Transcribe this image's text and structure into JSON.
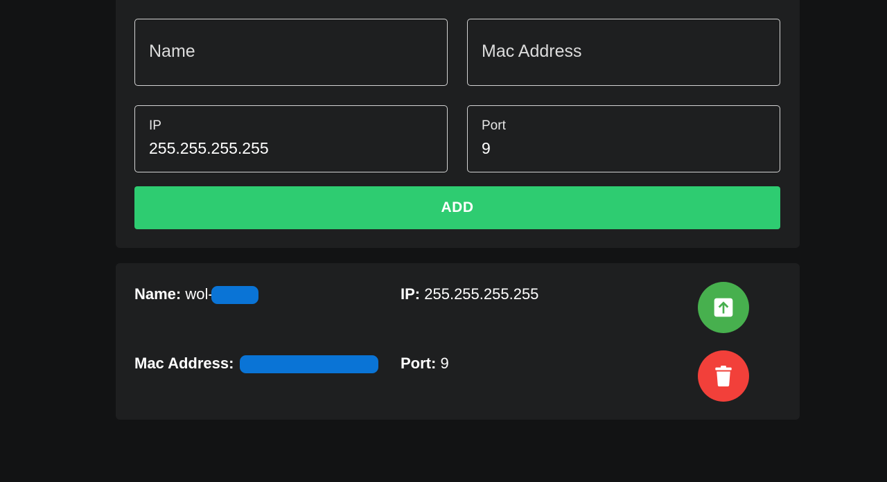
{
  "form": {
    "name_placeholder": "Name",
    "mac_placeholder": "Mac Address",
    "ip_label": "IP",
    "ip_value": "255.255.255.255",
    "port_label": "Port",
    "port_value": "9",
    "add_label": "ADD"
  },
  "device": {
    "name_label": "Name:",
    "name_value": "wol-",
    "mac_label": "Mac Address:",
    "ip_label": "IP:",
    "ip_value": "255.255.255.255",
    "port_label": "Port:",
    "port_value": "9",
    "wake_icon": "arrow-up-box-icon",
    "delete_icon": "trash-icon"
  },
  "colors": {
    "accent_green": "#2ecc71",
    "wake_green": "#47b04e",
    "delete_red": "#f2403a",
    "redaction_blue": "#0a74d6"
  }
}
